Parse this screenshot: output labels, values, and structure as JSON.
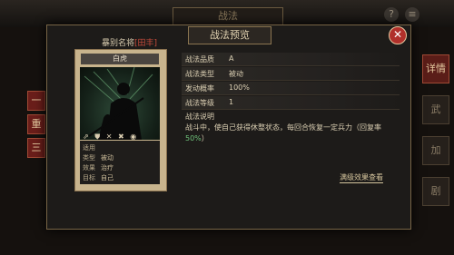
{
  "background": {
    "top_tab": "战法",
    "left_tags": [
      "一",
      "重",
      "三"
    ],
    "right_tabs": [
      "详情",
      "武",
      "加",
      "剧"
    ]
  },
  "dialog": {
    "title": "战法预览",
    "close_label": "✕",
    "tactic_name": "暴别名将",
    "tactic_name_tag": "[田丰]"
  },
  "card": {
    "header": "白虎",
    "icons": "⇗ ⛊ ✕ ✖ ◉",
    "rows": [
      {
        "k": "适用",
        "v": ""
      },
      {
        "k": "类型",
        "v": "被动"
      },
      {
        "k": "效果",
        "v": "治疗"
      },
      {
        "k": "目标",
        "v": "自己"
      }
    ]
  },
  "attributes": [
    {
      "k": "战法品质",
      "v": "A"
    },
    {
      "k": "战法类型",
      "v": "被动"
    },
    {
      "k": "发动概率",
      "v": "100%"
    },
    {
      "k": "战法等级",
      "v": "1"
    }
  ],
  "description": {
    "title": "战法说明",
    "text": "战斗中，使自己获得休整状态，每回合恢复一定兵力（回复率",
    "highlight": "50%",
    "suffix": "）"
  },
  "upgrade_link": "满级效果查看"
}
